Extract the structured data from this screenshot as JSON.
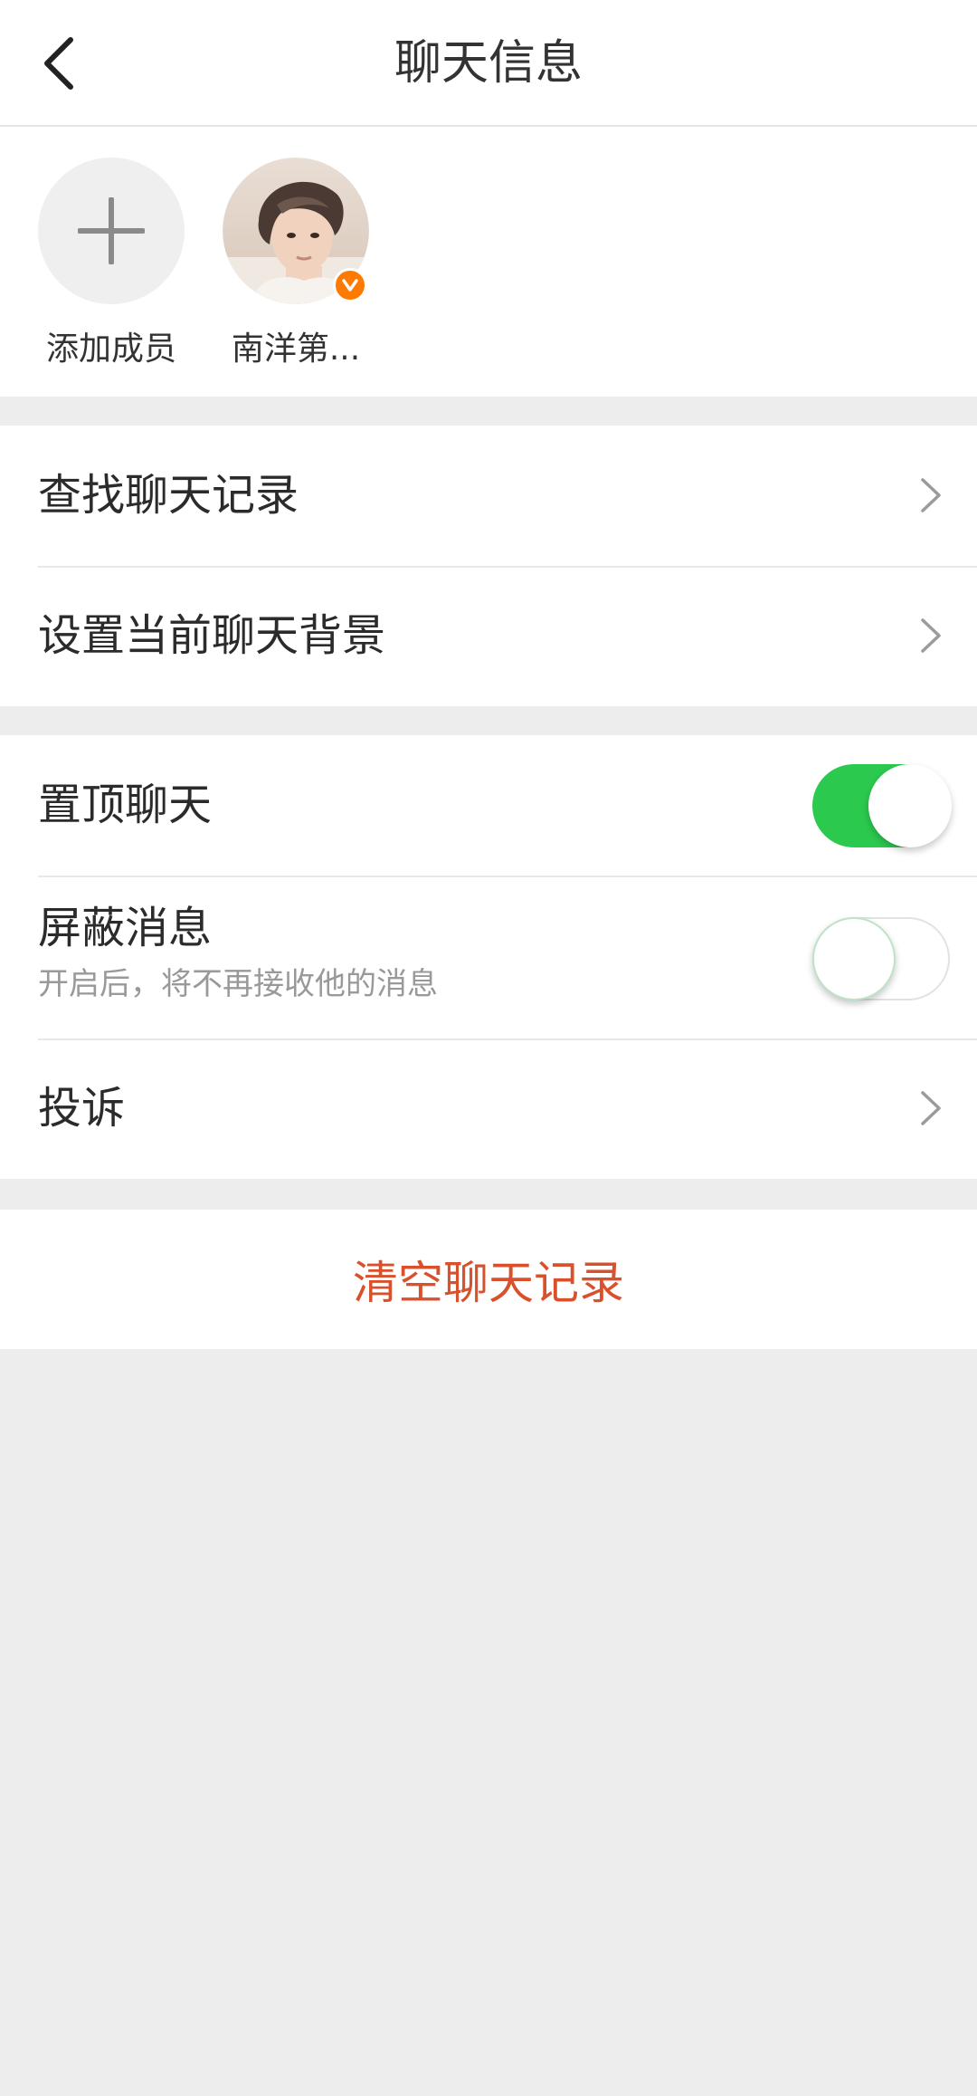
{
  "header": {
    "title": "聊天信息",
    "back_icon": "chevron-left-icon"
  },
  "members": [
    {
      "name": "添加成员",
      "icon": "plus-icon",
      "type": "add"
    },
    {
      "name": "南洋第...",
      "type": "user",
      "verified": true,
      "badge_icon": "verified-v-icon",
      "badge_color": "#ff7a00"
    }
  ],
  "menu_group_1": {
    "items": [
      {
        "label": "查找聊天记录",
        "icon": "chevron-right-icon"
      },
      {
        "label": "设置当前聊天背景",
        "icon": "chevron-right-icon"
      }
    ]
  },
  "menu_group_2": {
    "pin_chat": {
      "label": "置顶聊天",
      "enabled": true
    },
    "mute": {
      "label": "屏蔽消息",
      "subtitle": "开启后，将不再接收他的消息",
      "enabled": false
    },
    "report": {
      "label": "投诉",
      "icon": "chevron-right-icon"
    }
  },
  "clear_history": {
    "label": "清空聊天记录",
    "color": "#d9512c"
  },
  "colors": {
    "toggle_on": "#2cc94f",
    "background": "#ededed"
  }
}
